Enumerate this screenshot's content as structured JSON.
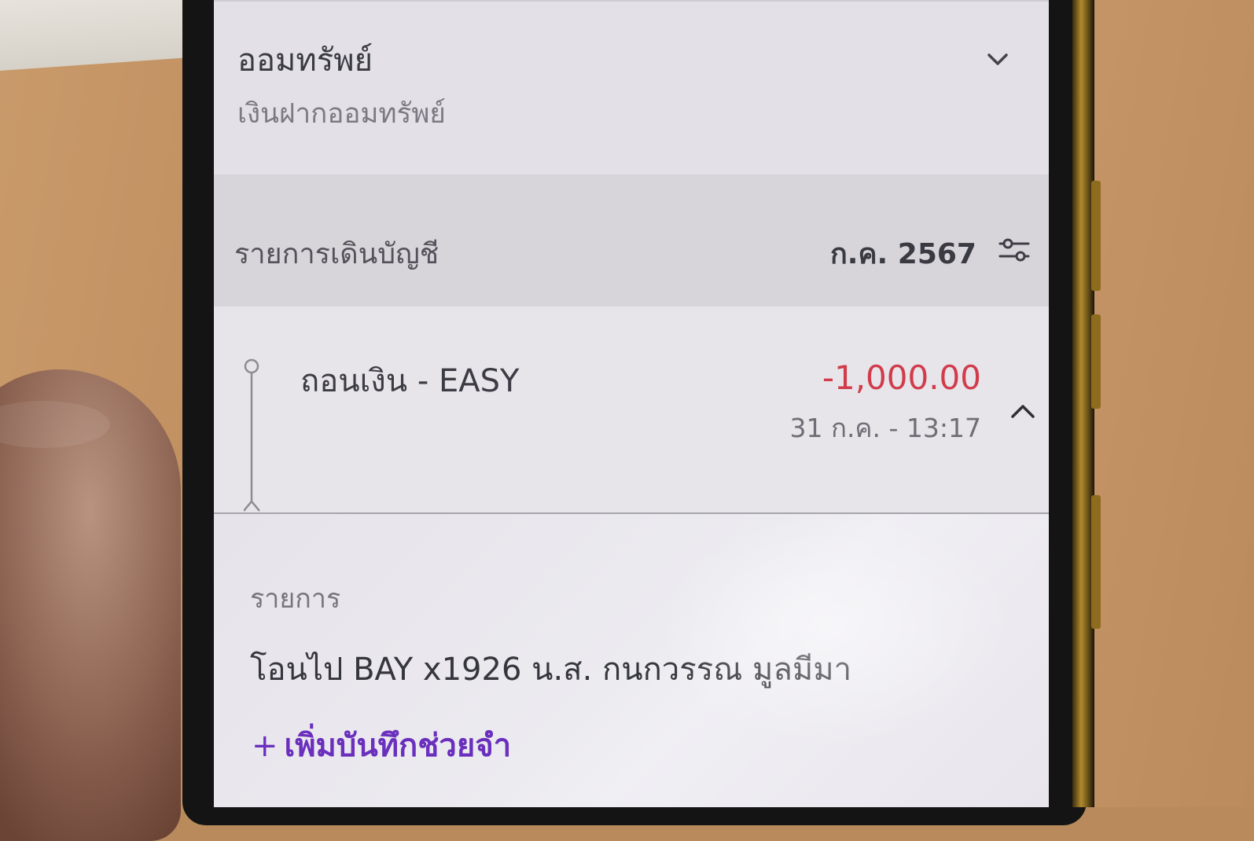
{
  "account": {
    "name": "ออมทรัพย์",
    "type": "เงินฝากออมทรัพย์"
  },
  "statement": {
    "title": "รายการเดินบัญชี",
    "month": "ก.ค. 2567"
  },
  "transaction": {
    "title": "ถอนเงิน - EASY",
    "amount": "-1,000.00",
    "datetime": "31 ก.ค. - 13:17",
    "amount_color": "#d13c4a"
  },
  "detail": {
    "label": "รายการ",
    "value": "โอนไป BAY x1926 น.ส. กนกวรรณ มูลมีมา",
    "add_memo_plus": "+",
    "add_memo_label": "เพิ่มบันทึกช่วยจำ",
    "accent_color": "#6a2fbd"
  },
  "icons": {
    "account_toggle": "chevron-down-icon",
    "filter": "filter-sliders-icon",
    "collapse": "chevron-up-icon",
    "timeline": "timeline-dot-icon"
  }
}
